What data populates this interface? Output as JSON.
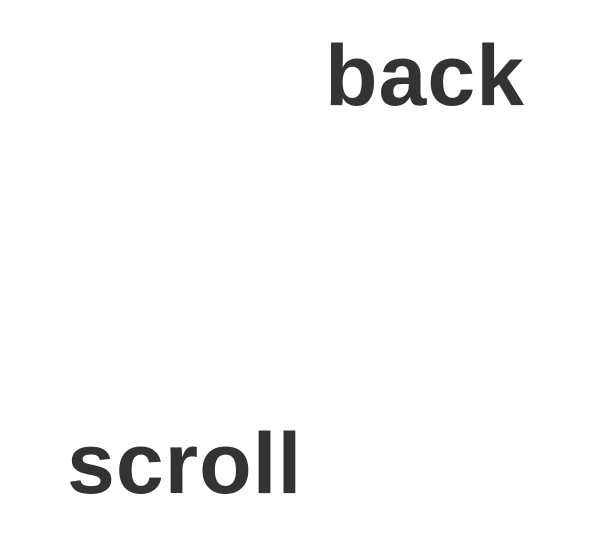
{
  "nav": {
    "back_label": "back",
    "scroll_label": "scroll"
  },
  "colors": {
    "background": "#ffffff",
    "text": "#333333"
  }
}
